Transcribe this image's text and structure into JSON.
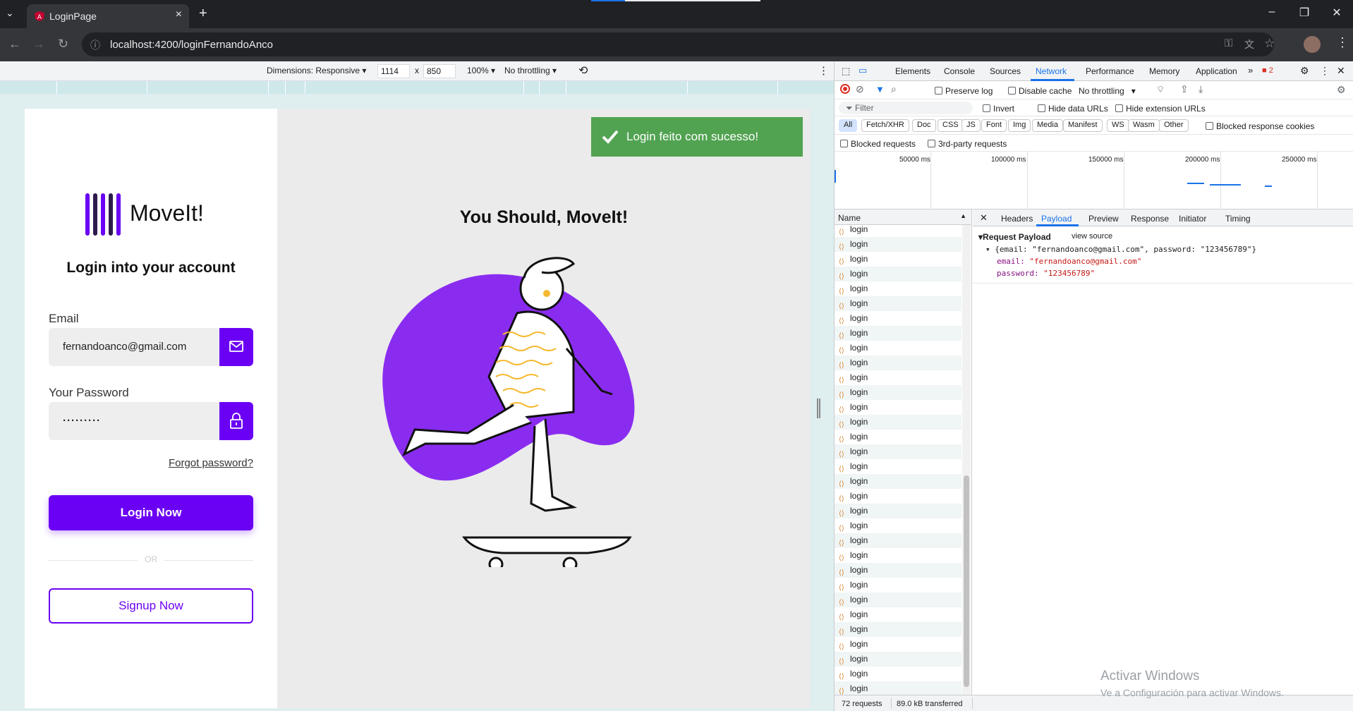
{
  "browser": {
    "tab_title": "LoginPage",
    "url": "localhost:4200/loginFernandoAnco"
  },
  "device_toolbar": {
    "dimensions_label": "Dimensions: Responsive",
    "width": "1114",
    "times": "x",
    "height": "850",
    "zoom": "100%",
    "throttling": "No throttling"
  },
  "login": {
    "logo_text": "MoveIt!",
    "title": "Login into your account",
    "email_label": "Email",
    "email_value": "fernandoanco@gmail.com",
    "password_label": "Your Password",
    "password_value": "·········",
    "forgot": "Forgot password?",
    "login_button": "Login Now",
    "or_text": "OR",
    "signup_button": "Signup Now"
  },
  "hero": {
    "title": "You Should, MoveIt!"
  },
  "toast": {
    "message": "Login feito com sucesso!"
  },
  "devtools": {
    "tabs": [
      "Elements",
      "Console",
      "Sources",
      "Network",
      "Performance",
      "Memory",
      "Application"
    ],
    "active_tab": "Network",
    "error_count": "2",
    "preserve_log": "Preserve log",
    "disable_cache": "Disable cache",
    "throttling": "No throttling",
    "filter_placeholder": "Filter",
    "invert": "Invert",
    "hide_data_urls": "Hide data URLs",
    "hide_extension_urls": "Hide extension URLs",
    "type_filters": [
      "All",
      "Fetch/XHR",
      "Doc",
      "CSS",
      "JS",
      "Font",
      "Img",
      "Media",
      "Manifest",
      "WS",
      "Wasm",
      "Other"
    ],
    "blocked_response_cookies": "Blocked response cookies",
    "blocked_requests": "Blocked requests",
    "third_party": "3rd-party requests",
    "timeline_labels": [
      "50000 ms",
      "100000 ms",
      "150000 ms",
      "200000 ms",
      "250000 ms"
    ],
    "name_header": "Name",
    "request_name": "login",
    "detail_tabs": [
      "Headers",
      "Payload",
      "Preview",
      "Response",
      "Initiator",
      "Timing"
    ],
    "active_detail_tab": "Payload",
    "payload_title": "Request Payload",
    "view_source": "view source",
    "payload_summary": "{email: \"fernandoanco@gmail.com\", password: \"123456789\"}",
    "email_key": "email:",
    "email_val": "\"fernandoanco@gmail.com\"",
    "password_key": "password:",
    "password_val": "\"123456789\"",
    "requests_count": "72 requests",
    "transferred": "89.0 kB transferred"
  },
  "watermark": {
    "line1": "Activar Windows",
    "line2": "Ve a Configuración para activar Windows."
  },
  "colors": {
    "brand_purple": "#6a00f4",
    "blob_purple": "#8a2cf0",
    "toast_green": "#51a351"
  }
}
